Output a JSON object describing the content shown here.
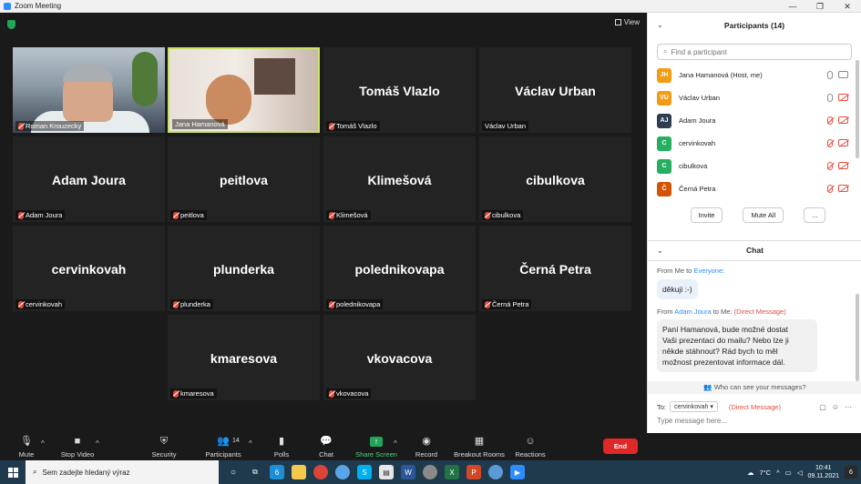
{
  "window": {
    "title": "Zoom Meeting",
    "controls": [
      "—",
      "❐",
      "✕"
    ]
  },
  "meeting": {
    "view_label": "View",
    "tiles": [
      {
        "name": "Roman Krouzecky",
        "big": "",
        "video": true,
        "muted": true,
        "active": false
      },
      {
        "name": "Jana Hamanová",
        "big": "",
        "video": true,
        "muted": false,
        "active": true
      },
      {
        "name": "Tomáš Vlazlo",
        "big": "Tomáš Vlazlo",
        "video": false,
        "muted": true,
        "active": false
      },
      {
        "name": "Václav Urban",
        "big": "Václav Urban",
        "video": false,
        "muted": false,
        "active": false
      },
      {
        "name": "Adam Joura",
        "big": "Adam Joura",
        "video": false,
        "muted": true,
        "active": false
      },
      {
        "name": "peitlova",
        "big": "peitlova",
        "video": false,
        "muted": true,
        "active": false
      },
      {
        "name": "Klimešová",
        "big": "Klimešová",
        "video": false,
        "muted": true,
        "active": false
      },
      {
        "name": "cibulkova",
        "big": "cibulkova",
        "video": false,
        "muted": true,
        "active": false
      },
      {
        "name": "cervinkovah",
        "big": "cervinkovah",
        "video": false,
        "muted": true,
        "active": false
      },
      {
        "name": "plunderka",
        "big": "plunderka",
        "video": false,
        "muted": true,
        "active": false
      },
      {
        "name": "polednikovapa",
        "big": "polednikovapa",
        "video": false,
        "muted": true,
        "active": false
      },
      {
        "name": "Černá Petra",
        "big": "Černá Petra",
        "video": false,
        "muted": true,
        "active": false
      },
      {
        "name": "kmaresova",
        "big": "kmaresova",
        "video": false,
        "muted": true,
        "active": false
      },
      {
        "name": "vkovacova",
        "big": "vkovacova",
        "video": false,
        "muted": true,
        "active": false
      }
    ]
  },
  "participants": {
    "title": "Participants (14)",
    "search_placeholder": "Find a participant",
    "list": [
      {
        "initials": "JH",
        "name": "Jana Hamanová (Host, me)",
        "color": "#f39c12",
        "mic_off": false,
        "cam_off": false
      },
      {
        "initials": "VU",
        "name": "Václav Urban",
        "color": "#f39c12",
        "mic_off": false,
        "cam_off": true
      },
      {
        "initials": "AJ",
        "name": "Adam Joura",
        "color": "#2c3e50",
        "mic_off": true,
        "cam_off": true
      },
      {
        "initials": "C",
        "name": "cervinkovah",
        "color": "#27ae60",
        "mic_off": true,
        "cam_off": true
      },
      {
        "initials": "C",
        "name": "cibulkova",
        "color": "#27ae60",
        "mic_off": true,
        "cam_off": true
      },
      {
        "initials": "Č",
        "name": "Černá Petra",
        "color": "#d35400",
        "mic_off": true,
        "cam_off": true
      }
    ],
    "invite": "Invite",
    "mute_all": "Mute All",
    "more": "..."
  },
  "chat": {
    "title": "Chat",
    "msg1": {
      "from_prefix": "From Me to ",
      "to": "Everyone",
      "from_suffix": ":",
      "text": "děkuji :-)"
    },
    "msg2": {
      "from_prefix": "From ",
      "sender": "Adam Joura",
      "from_mid": " to Me: ",
      "dm": "(Direct Message)",
      "lines": [
        "Paní Hamanová, bude možné dostat",
        "Vaši prezentaci do mailu? Nebo lze ji",
        "někde stáhnout? Rád bych to měl",
        "možnost prezentovat informace dál."
      ]
    },
    "who_can_see": "Who can see your messages?",
    "to_label": "To:",
    "to_value": "cervinkovah",
    "to_dm": "(Direct Message)",
    "input_placeholder": "Type message here..."
  },
  "toolbar": {
    "mute": "Mute",
    "stop_video": "Stop Video",
    "security": "Security",
    "participants": "Participants",
    "participants_count": "14",
    "polls": "Polls",
    "chat": "Chat",
    "share_screen": "Share Screen",
    "record": "Record",
    "breakout": "Breakout Rooms",
    "reactions": "Reactions",
    "end": "End"
  },
  "taskbar": {
    "search_placeholder": "Sem zadejte hledaný výraz",
    "weather": "7°C",
    "time": "10:41",
    "date": "09.11.2021",
    "notifications": "6",
    "edge_badge": "6"
  },
  "colors": {
    "end": "#e02828",
    "share": "#23a559",
    "active_border": "#c9e265",
    "accent": "#2d8cff"
  }
}
